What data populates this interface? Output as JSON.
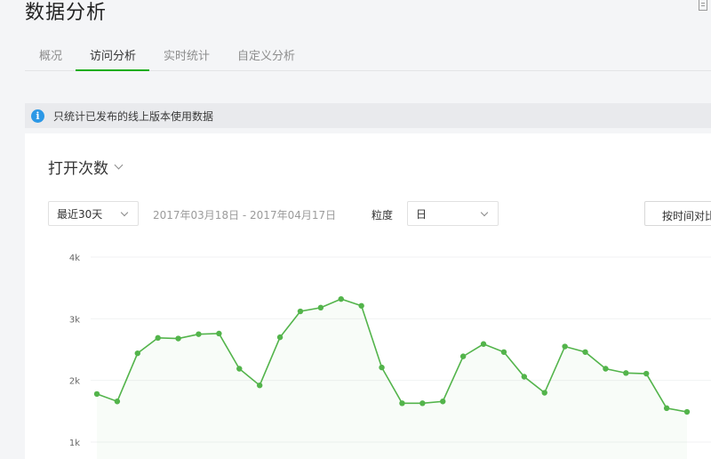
{
  "header": {
    "title": "数据分析"
  },
  "tabs": [
    {
      "label": "概况",
      "active": false
    },
    {
      "label": "访问分析",
      "active": true
    },
    {
      "label": "实时统计",
      "active": false
    },
    {
      "label": "自定义分析",
      "active": false
    }
  ],
  "notice": {
    "icon": "i",
    "text": "只统计已发布的线上版本使用数据"
  },
  "metric": {
    "label": "打开次数"
  },
  "filters": {
    "range": "最近30天",
    "date_range": "2017年03月18日 - 2017年04月17日",
    "grain_label": "粒度",
    "grain": "日",
    "compare": "按时间对比"
  },
  "colors": {
    "accent": "#1aad19",
    "line": "#53b44b",
    "info": "#2c98e6"
  },
  "chart_data": {
    "type": "line",
    "ylim": [
      1000,
      4000
    ],
    "yticks": [
      {
        "value": 1000,
        "label": "1k"
      },
      {
        "value": 2000,
        "label": "2k"
      },
      {
        "value": 3000,
        "label": "3k"
      },
      {
        "value": 4000,
        "label": "4k"
      }
    ],
    "grid": true,
    "series": [
      {
        "values": [
          1780,
          1660,
          2440,
          2690,
          2680,
          2750,
          2760,
          2190,
          1920,
          2700,
          3120,
          3180,
          3320,
          3210,
          2210,
          1630,
          1630,
          1660,
          2390,
          2590,
          2460,
          2060,
          1800,
          2550,
          2460,
          2190,
          2120,
          2110,
          1550,
          1490
        ]
      }
    ]
  }
}
